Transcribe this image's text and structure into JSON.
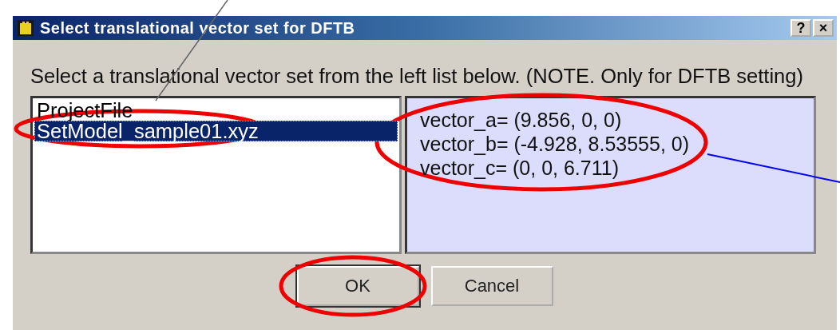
{
  "window": {
    "title": "Select translational vector set for DFTB",
    "title_buttons": [
      "?",
      "×"
    ]
  },
  "instruction": "Select a translational vector set from the left list below. (NOTE. Only for DFTB setting)",
  "list": [
    {
      "label": "ProjectFile",
      "selected": false
    },
    {
      "label": "SetModel_sample01.xyz",
      "selected": true
    }
  ],
  "vectors": [
    "vector_a= (9.856, 0, 0)",
    "vector_b= (-4.928, 8.53555, 0)",
    "vector_c= (0, 0, 6.711)"
  ],
  "buttons": [
    {
      "label": "OK",
      "default": true
    },
    {
      "label": "Cancel",
      "default": false
    }
  ]
}
